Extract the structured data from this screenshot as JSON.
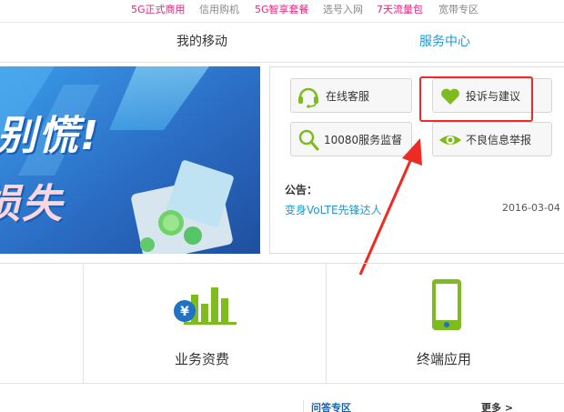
{
  "top_nav": [
    {
      "label": "5G正式商用",
      "color": "#e5247e"
    },
    {
      "label": "信用购机",
      "color": "#888888"
    },
    {
      "label": "5G智享套餐",
      "color": "#e5247e"
    },
    {
      "label": "选号入网",
      "color": "#888888"
    },
    {
      "label": "7天流量包",
      "color": "#e5247e"
    },
    {
      "label": "宽带专区",
      "color": "#888888"
    }
  ],
  "tabs": {
    "mine": "我的移动",
    "service": "服务中心"
  },
  "banner": {
    "line1": "别慌!",
    "line2": "损失"
  },
  "services": [
    {
      "label": "在线客服",
      "icon": "headset-icon"
    },
    {
      "label": "投诉与建议",
      "icon": "heart-icon"
    },
    {
      "label": "10080服务监督",
      "icon": "magnifier-icon"
    },
    {
      "label": "不良信息举报",
      "icon": "eye-icon"
    }
  ],
  "notice": {
    "title": "公告：",
    "link": "变身VoLTE先锋达人",
    "date": "2016-03-04"
  },
  "categories": [
    {
      "label": "业务资费",
      "icon": "yuan-bar-chart-icon"
    },
    {
      "label": "终端应用",
      "icon": "phone-icon"
    }
  ],
  "bottom": {
    "qa": "问答专区",
    "more": "更多 >"
  },
  "colors": {
    "accent_blue": "#1b9ad8",
    "promo_pink": "#e5247e",
    "icon_green": "#7dbb1e",
    "highlight_red": "#ee2a22"
  }
}
